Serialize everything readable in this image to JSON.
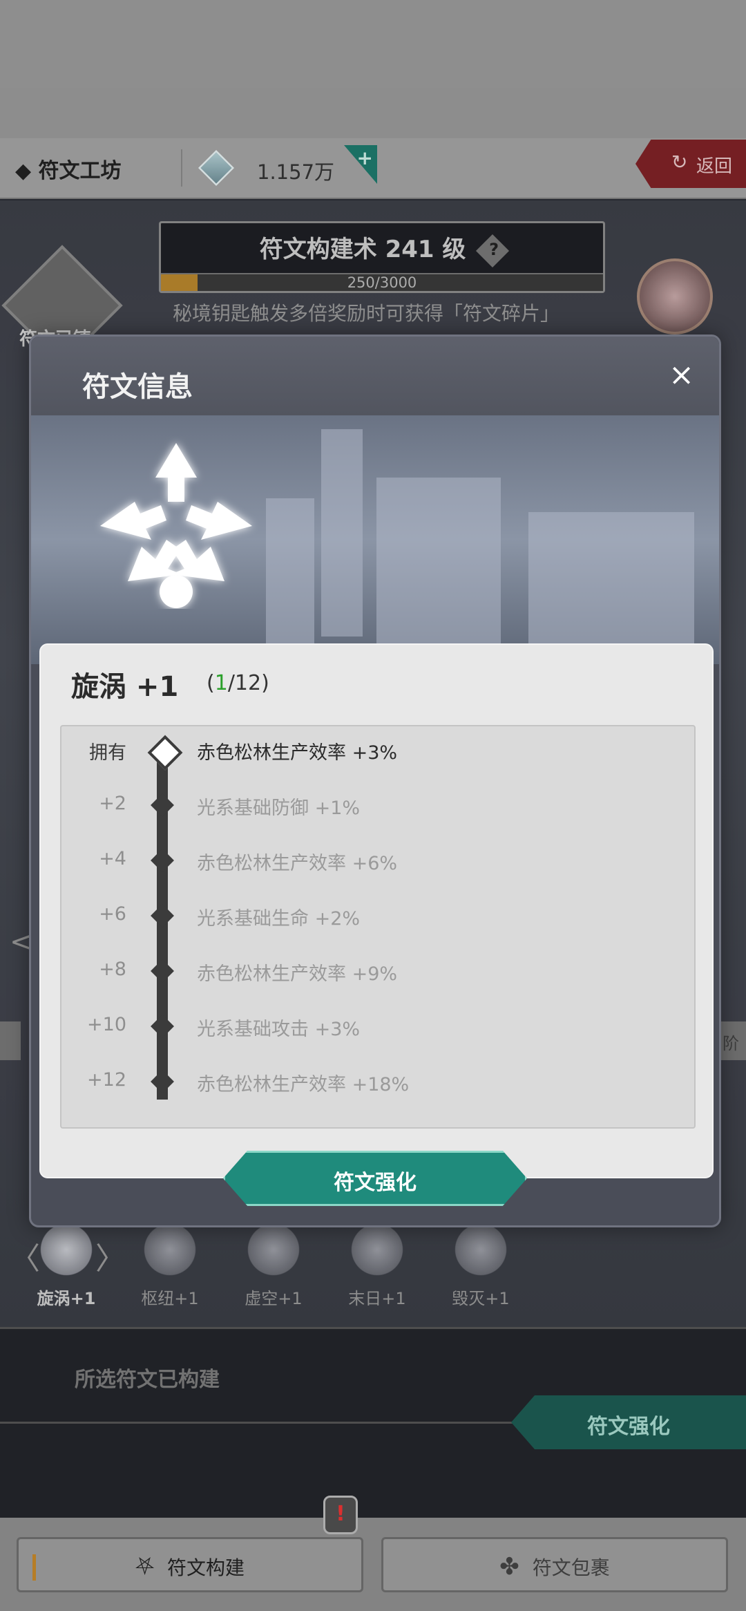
{
  "header": {
    "title": "◆ 符文工坊",
    "currency_value": "1.157万",
    "currency_add": "+",
    "back_label": "返回"
  },
  "level_panel": {
    "title": "符文构建术 241 级",
    "help": "?",
    "progress_text": "250/3000",
    "progress_fraction": 0.083
  },
  "hint": "秘境钥匙触发多倍奖励时可获得「符文碎片」",
  "left_badge_label": "符文已铸",
  "side_tab_right": "阶",
  "modal": {
    "title": "符文信息",
    "close": "×",
    "rune_name": "旋涡 +1",
    "count_open": "(",
    "count_current": "1",
    "count_rest": "/12)",
    "effects": [
      {
        "level": "拥有",
        "text": "赤色松林生产效率 +3%",
        "owned": true
      },
      {
        "level": "+2",
        "text": "光系基础防御 +1%",
        "owned": false
      },
      {
        "level": "+4",
        "text": "赤色松林生产效率 +6%",
        "owned": false
      },
      {
        "level": "+6",
        "text": "光系基础生命 +2%",
        "owned": false
      },
      {
        "level": "+8",
        "text": "赤色松林生产效率 +9%",
        "owned": false
      },
      {
        "level": "+10",
        "text": "光系基础攻击 +3%",
        "owned": false
      },
      {
        "level": "+12",
        "text": "赤色松林生产效率 +18%",
        "owned": false
      }
    ],
    "enhance_label": "符文强化"
  },
  "rune_strip": [
    {
      "label": "旋涡+1",
      "selected": true
    },
    {
      "label": "枢纽+1",
      "selected": false
    },
    {
      "label": "虚空+1",
      "selected": false
    },
    {
      "label": "末日+1",
      "selected": false
    },
    {
      "label": "毁灭+1",
      "selected": false
    }
  ],
  "built_section": {
    "status": "所选符文已构建",
    "enhance_label": "符文强化"
  },
  "bottom_nav": {
    "build_label": "符文构建",
    "bag_label": "符文包裹",
    "alert": "!"
  }
}
